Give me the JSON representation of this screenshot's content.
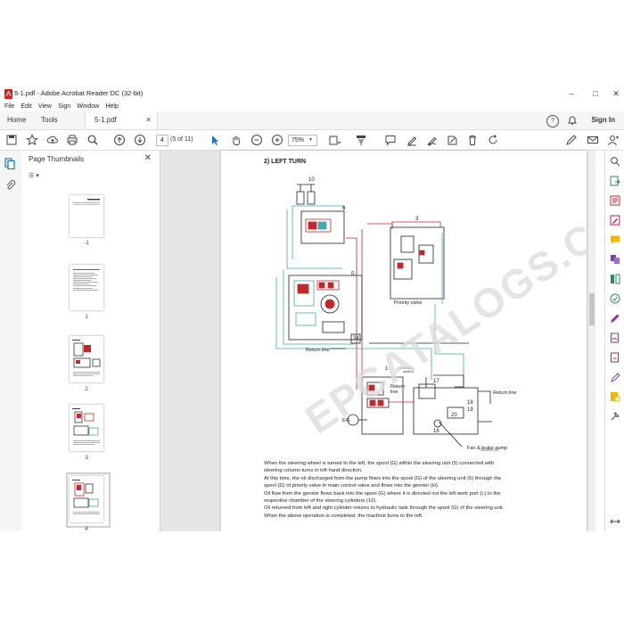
{
  "window": {
    "title": "5-1.pdf - Adobe Acrobat Reader DC (32-bit)",
    "controls": [
      "–",
      "□",
      "✕"
    ]
  },
  "menu": [
    "File",
    "Edit",
    "View",
    "Sign",
    "Window",
    "Help"
  ],
  "tabs": {
    "home": "Home",
    "tools": "Tools",
    "document": "5-1.pdf",
    "close": "✕"
  },
  "header_right": {
    "help_icon": "?",
    "bell_icon": "bell-icon",
    "sign_in": "Sign In"
  },
  "toolbar": {
    "page_current": "4",
    "page_count": "(5 of 11)",
    "zoom": "75%"
  },
  "thumbnails": {
    "panel_title": "Page Thumbnails",
    "close": "✕",
    "options": "☰ ▾",
    "items": [
      {
        "label": "-1"
      },
      {
        "label": "1"
      },
      {
        "label": "2"
      },
      {
        "label": "3"
      },
      {
        "label": "4"
      }
    ]
  },
  "document": {
    "heading": "2) LEFT TURN",
    "watermark": "EPCATALOGS.COM",
    "figure_id": "7609A5ECS5",
    "diagram_labels": {
      "n10": "10",
      "n6": "6",
      "n3": "3",
      "n5": "5",
      "n34": "34",
      "n1": "1",
      "n17": "17",
      "n18": "18",
      "n19": "19",
      "n20": "20",
      "n16": "16",
      "priority_valve": "Priority valve",
      "return_line_1": "Return line",
      "return_line_2": "Return line",
      "return_line_3": "Return",
      "return_line_3b": "line",
      "fan_brake_pump": "Fan & brake pump",
      "eg": "E/G"
    },
    "paragraphs": [
      "When the steering wheel is turned to the left, the spool (G) within the steering unit (5) connected with steering column turns in left hand direction.",
      "At this time, the oil discharged from the pump flows into the spool (G) of the steering unit (5) through the spool (D) of priority valve in main control valve and flows into the gerotor (H).",
      "Oil flow from the gerotor flows back into the spool (G) where it is directed out the  left work port (L) to the respective chamber of the steering cylinders (10).",
      "Oil returned from left and right cylinder returns to hydraulic tank through the spool (G) of the steering unit.",
      "When the above operation is completed, the machine turns to the left."
    ]
  },
  "colors": {
    "accent_blue": "#1a73c9",
    "diagram_red": "#c0282b",
    "diagram_cyan": "#3fa9b6",
    "diagram_black": "#222222"
  }
}
